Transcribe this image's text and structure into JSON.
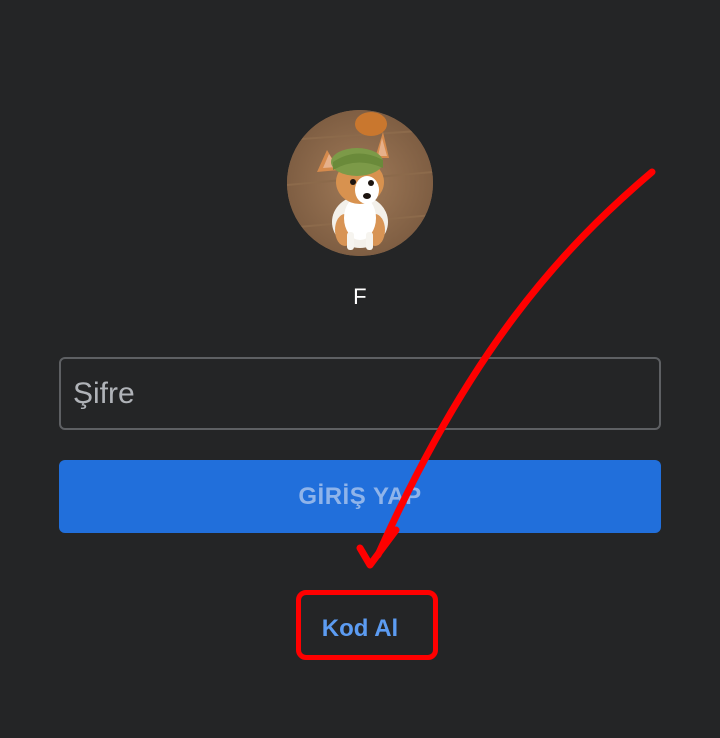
{
  "profile": {
    "avatar_icon": "dog-photo-avatar",
    "username": "F"
  },
  "form": {
    "password_placeholder": "Şifre",
    "login_label": "GİRİŞ YAP"
  },
  "actions": {
    "get_code_label": "Kod Al"
  },
  "annotation": {
    "color": "#ff0000",
    "arrow_icon": "arrow-annotation",
    "box_icon": "highlight-box"
  },
  "colors": {
    "background": "#242526",
    "primary_button": "#216fdb",
    "link": "#5c9cf2",
    "input_border": "#5e6063"
  }
}
